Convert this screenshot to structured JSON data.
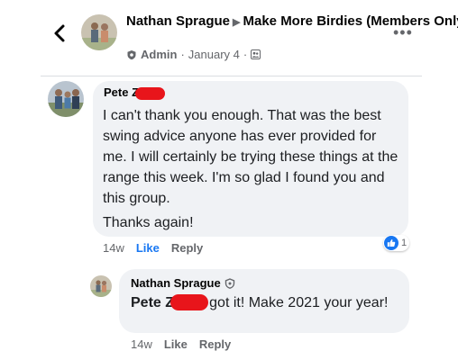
{
  "header": {
    "author": "Nathan Sprague",
    "group": "Make More Birdies (Members Only)",
    "role": "Admin",
    "date": "January 4"
  },
  "comment": {
    "name": "Pete Z",
    "body": "I can't thank you enough. That was the best swing advice anyone has ever provided for me. I will certainly be trying these things at the range this week. I'm so glad I found you and this group.",
    "thanks": "Thanks again!",
    "age": "14w",
    "like_label": "Like",
    "reply_label": "Reply",
    "reaction_count": "1",
    "reaction_icon": "like-icon",
    "like_color": "#1877f2"
  },
  "reply": {
    "name": "Nathan Sprague",
    "mention": "Pete Z",
    "body": ", you got it!  Make 2021 your year!",
    "age": "14w",
    "like_label": "Like",
    "reply_label": "Reply"
  },
  "colors": {
    "bubble": "#f0f2f5",
    "redaction": "#e8151b",
    "muted": "#65676b"
  }
}
